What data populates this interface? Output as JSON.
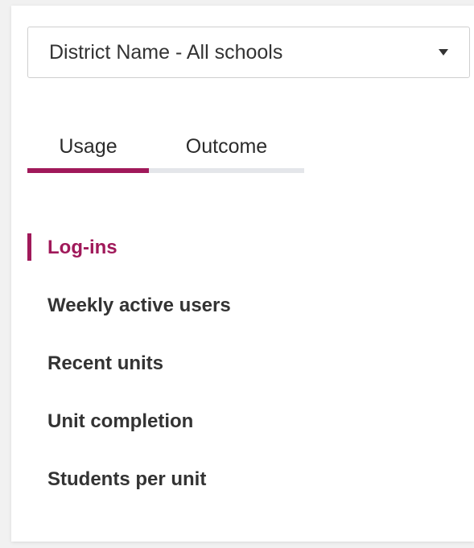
{
  "filter": {
    "selected": "District Name - All schools"
  },
  "tabs": [
    {
      "label": "Usage",
      "active": true
    },
    {
      "label": "Outcome",
      "active": false
    }
  ],
  "metrics": [
    {
      "label": "Log-ins",
      "active": true
    },
    {
      "label": "Weekly active users",
      "active": false
    },
    {
      "label": "Recent units",
      "active": false
    },
    {
      "label": "Unit completion",
      "active": false
    },
    {
      "label": "Students per unit",
      "active": false
    }
  ],
  "colors": {
    "accent": "#a0195a",
    "tab_track": "#e4e6ea",
    "text": "#333333",
    "background": "#ffffff"
  },
  "icons": {
    "dropdown": "caret-down-icon"
  }
}
